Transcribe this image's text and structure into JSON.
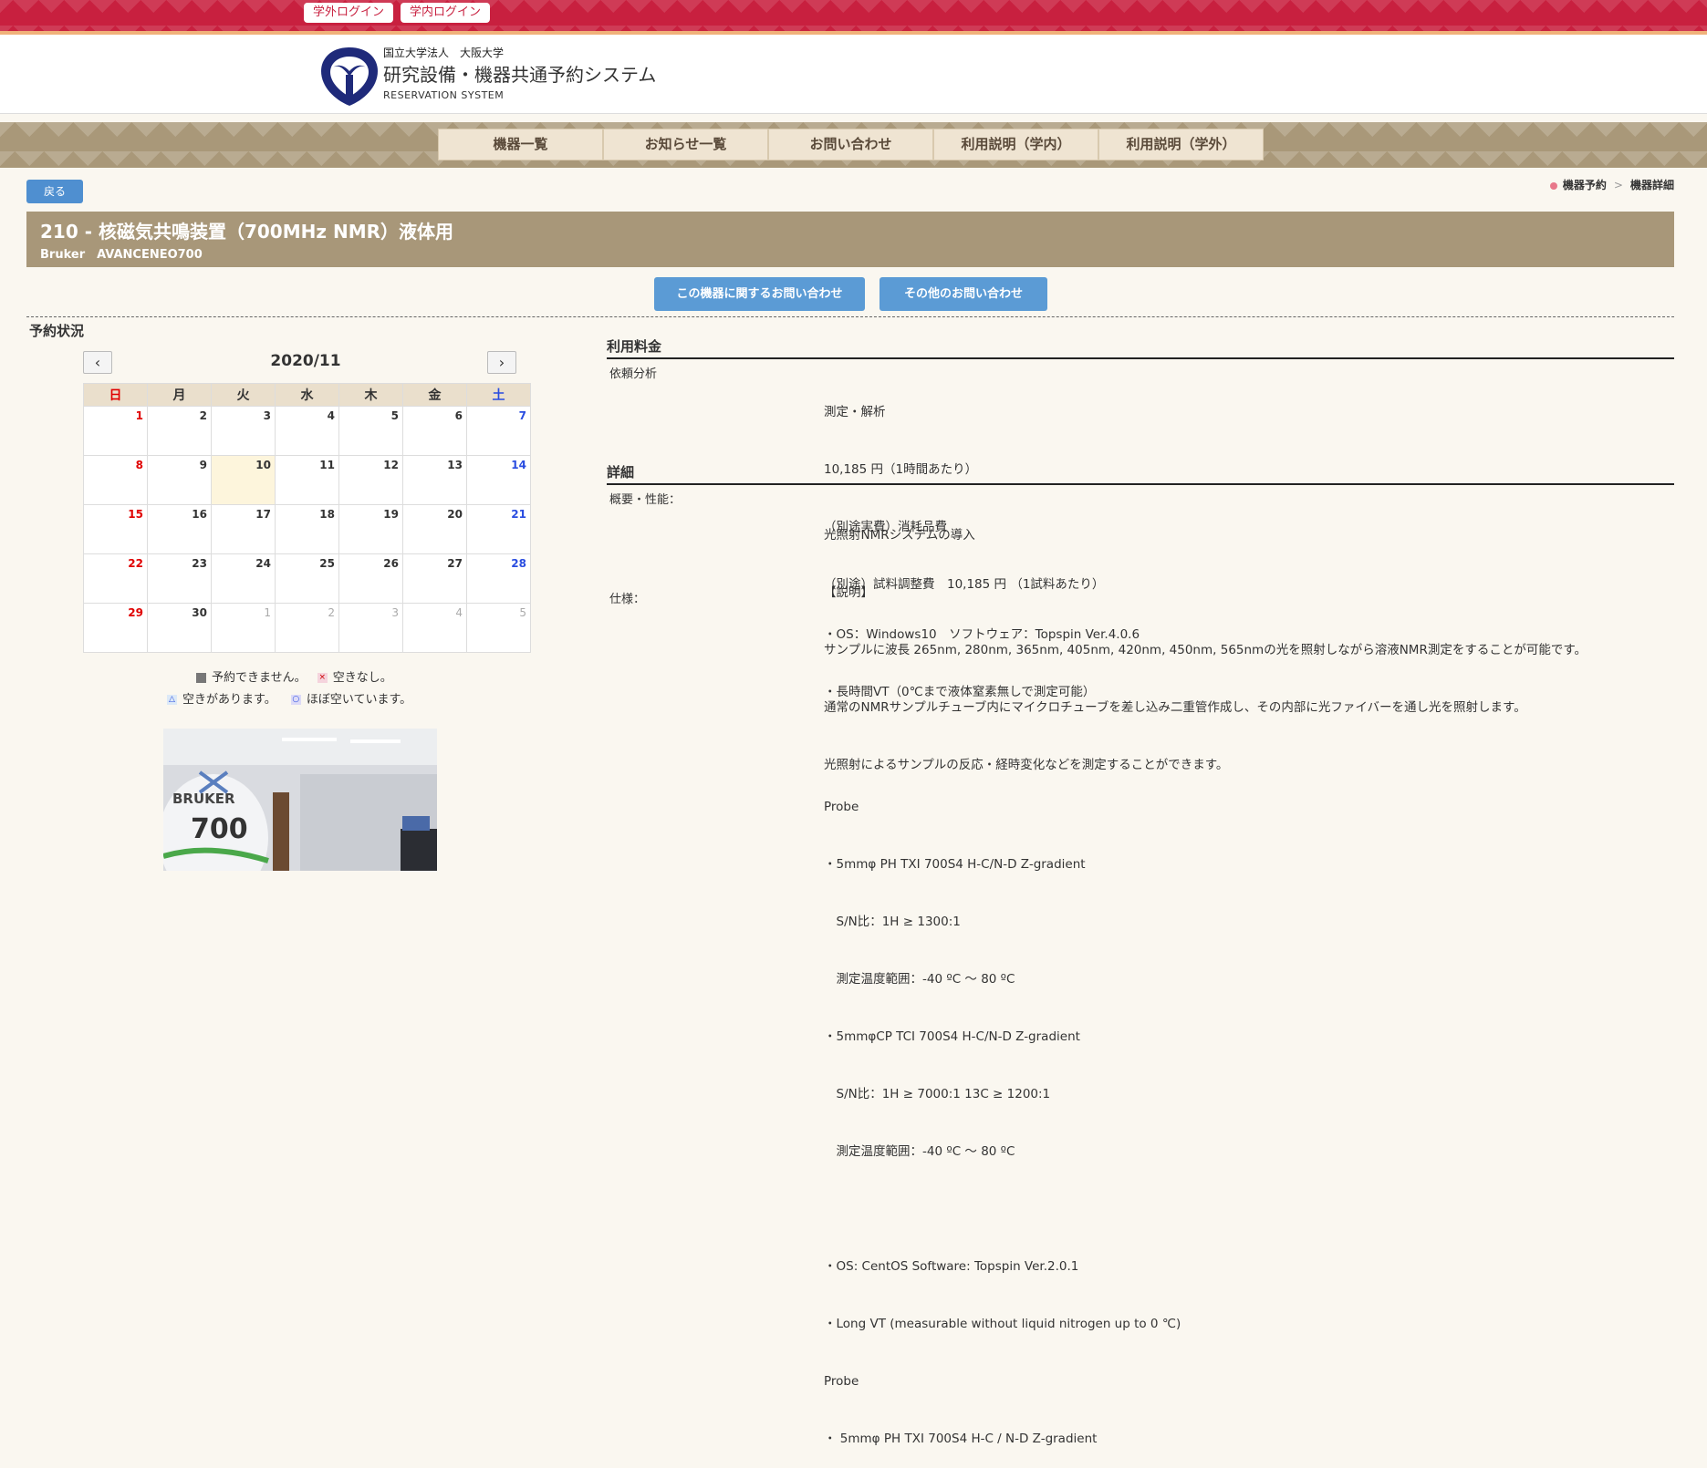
{
  "top": {
    "login_external": "学外ログイン",
    "login_internal": "学内ログイン"
  },
  "header": {
    "org": "国立大学法人　大阪大学",
    "system_name": "研究設備・機器共通予約システム",
    "system_sub": "RESERVATION SYSTEM"
  },
  "nav": [
    "機器一覧",
    "お知らせ一覧",
    "お問い合わせ",
    "利用説明（学内）",
    "利用説明（学外）"
  ],
  "back_label": "戻る",
  "breadcrumb": {
    "first": "機器予約",
    "sep": ">",
    "current": "機器詳細"
  },
  "equipment": {
    "title": "210 - 核磁気共鳴装置（700MHz NMR）液体用",
    "maker_model": "Bruker　AVANCENEO700"
  },
  "buttons": {
    "inquiry_this": "この機器に関するお問い合わせ",
    "inquiry_other": "その他のお問い合わせ"
  },
  "calendar": {
    "section_title": "予約状況",
    "month": "2020/11",
    "prev": "‹",
    "next": "›",
    "weekdays": [
      "日",
      "月",
      "火",
      "水",
      "木",
      "金",
      "土"
    ],
    "weeks": [
      [
        "1",
        "2",
        "3",
        "4",
        "5",
        "6",
        "7"
      ],
      [
        "8",
        "9",
        "10",
        "11",
        "12",
        "13",
        "14"
      ],
      [
        "15",
        "16",
        "17",
        "18",
        "19",
        "20",
        "21"
      ],
      [
        "22",
        "23",
        "24",
        "25",
        "26",
        "27",
        "28"
      ],
      [
        "29",
        "30",
        "1",
        "2",
        "3",
        "4",
        "5"
      ]
    ],
    "legend": {
      "unavailable": "予約できません。",
      "full_mark": "×",
      "full": "空きなし。",
      "some_mark": "△",
      "some": "空きがあります。",
      "most_mark": "○",
      "most": "ほぼ空いています。"
    }
  },
  "fees": {
    "heading": "利用料金",
    "label": "依頼分析",
    "lines": [
      "測定・解析",
      "10,185 円（1時間あたり）",
      "（別途実費）消耗品費",
      "（別途）試料調整費　10,185 円 （1試料あたり）"
    ]
  },
  "details": {
    "heading": "詳細",
    "overview_label": "概要・性能：",
    "overview_lines": [
      "光照射NMRシステムの導入",
      "【説明】",
      "サンプルに波長 265nm, 280nm, 365nm, 405nm, 420nm, 450nm, 565nmの光を照射しながら溶液NMR測定をすることが可能です。",
      "通常のNMRサンプルチューブ内にマイクロチューブを差し込み二重管作成し、その内部に光ファイバーを通し光を照射します。",
      "光照射によるサンプルの反応・経時変化などを測定することができます。"
    ],
    "spec_label": "仕様：",
    "spec_lines": [
      "・OS：Windows10　ソフトウェア：Topspin Ver.4.0.6",
      "・長時間VT（0℃まで液体窒素無しで測定可能）",
      "",
      "Probe",
      "・5mmφ PH TXI 700S4 H-C/N-D Z-gradient",
      "　S/N比：1H ≥ 1300:1",
      "　測定温度範囲：-40 ºC ～ 80 ºC",
      "・5mmφCP TCI 700S4 H-C/N-D Z-gradient",
      "　S/N比：1H ≥ 7000:1 13C ≥ 1200:1",
      "　測定温度範囲：-40 ºC ～ 80 ºC",
      "",
      "・OS: CentOS Software: Topspin Ver.2.0.1",
      "・Long VT (measurable without liquid nitrogen up to 0 ℃)",
      "Probe",
      "・ 5mmφ PH TXI 700S4 H-C / N-D Z-gradient"
    ]
  },
  "colors": {
    "brand_red": "#c8203f",
    "nav_brown": "#a99879",
    "button_blue": "#5b9bd5"
  }
}
